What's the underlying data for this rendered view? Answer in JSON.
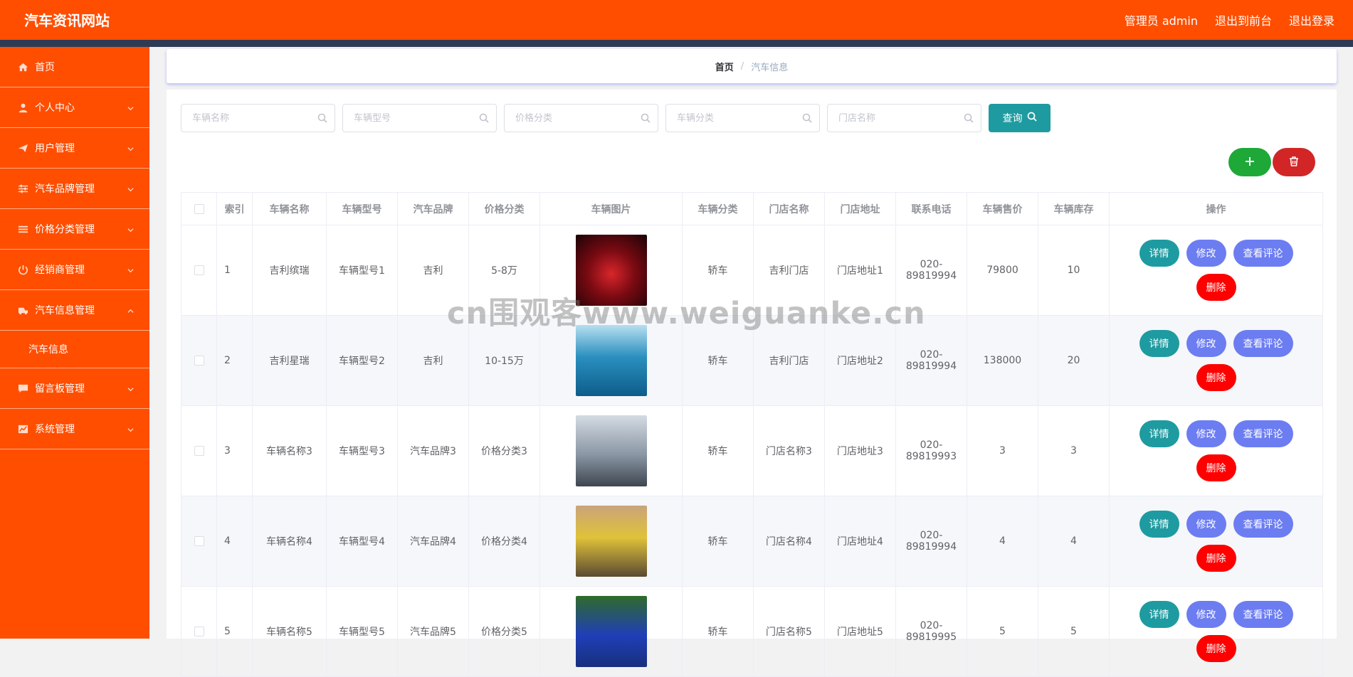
{
  "header": {
    "title": "汽车资讯网站",
    "links": [
      "管理员 admin",
      "退出到前台",
      "退出登录"
    ]
  },
  "sidebar": {
    "items": [
      {
        "label": "首页",
        "icon": "home-icon",
        "arrow": false
      },
      {
        "label": "个人中心",
        "icon": "user-icon",
        "arrow": true
      },
      {
        "label": "用户管理",
        "icon": "paper-plane-icon",
        "arrow": true
      },
      {
        "label": "汽车品牌管理",
        "icon": "sliders-icon",
        "arrow": true
      },
      {
        "label": "价格分类管理",
        "icon": "list-icon",
        "arrow": true
      },
      {
        "label": "经销商管理",
        "icon": "power-icon",
        "arrow": true
      },
      {
        "label": "汽车信息管理",
        "icon": "car-icon",
        "arrow": true,
        "open": true
      },
      {
        "label": "留言板管理",
        "icon": "chat-icon",
        "arrow": true
      },
      {
        "label": "系统管理",
        "icon": "chart-icon",
        "arrow": true
      }
    ],
    "sub_item": "汽车信息"
  },
  "breadcrumb": {
    "home": "首页",
    "separator": "/",
    "current": "汽车信息"
  },
  "search": {
    "placeholders": [
      "车辆名称",
      "车辆型号",
      "价格分类",
      "车辆分类",
      "门店名称"
    ],
    "query_label": "查询"
  },
  "table": {
    "headers": [
      "索引",
      "车辆名称",
      "车辆型号",
      "汽车品牌",
      "价格分类",
      "车辆图片",
      "车辆分类",
      "门店名称",
      "门店地址",
      "联系电话",
      "车辆售价",
      "车辆库存",
      "操作"
    ],
    "rows": [
      {
        "index": "1",
        "name": "吉利缤瑞",
        "model": "车辆型号1",
        "brand": "吉利",
        "price_class": "5-8万",
        "category": "轿车",
        "store": "吉利门店",
        "address": "门店地址1",
        "phone": "020-89819994",
        "price": "79800",
        "stock": "10"
      },
      {
        "index": "2",
        "name": "吉利星瑞",
        "model": "车辆型号2",
        "brand": "吉利",
        "price_class": "10-15万",
        "category": "轿车",
        "store": "吉利门店",
        "address": "门店地址2",
        "phone": "020-89819994",
        "price": "138000",
        "stock": "20"
      },
      {
        "index": "3",
        "name": "车辆名称3",
        "model": "车辆型号3",
        "brand": "汽车品牌3",
        "price_class": "价格分类3",
        "category": "轿车",
        "store": "门店名称3",
        "address": "门店地址3",
        "phone": "020-89819993",
        "price": "3",
        "stock": "3"
      },
      {
        "index": "4",
        "name": "车辆名称4",
        "model": "车辆型号4",
        "brand": "汽车品牌4",
        "price_class": "价格分类4",
        "category": "轿车",
        "store": "门店名称4",
        "address": "门店地址4",
        "phone": "020-89819994",
        "price": "4",
        "stock": "4"
      },
      {
        "index": "5",
        "name": "车辆名称5",
        "model": "车辆型号5",
        "brand": "汽车品牌5",
        "price_class": "价格分类5",
        "category": "轿车",
        "store": "门店名称5",
        "address": "门店地址5",
        "phone": "020-89819995",
        "price": "5",
        "stock": "5"
      }
    ],
    "ops": {
      "detail": "详情",
      "edit": "修改",
      "comment": "查看评论",
      "delete": "删除"
    }
  },
  "watermark": "cn围观客www.weiguanke.cn",
  "colors": {
    "primary": "#ff4e00",
    "teal": "#1e9ba0",
    "indigo": "#6c7df2",
    "green": "#1ea838",
    "red": "#d22626",
    "danger": "#ff0000"
  }
}
